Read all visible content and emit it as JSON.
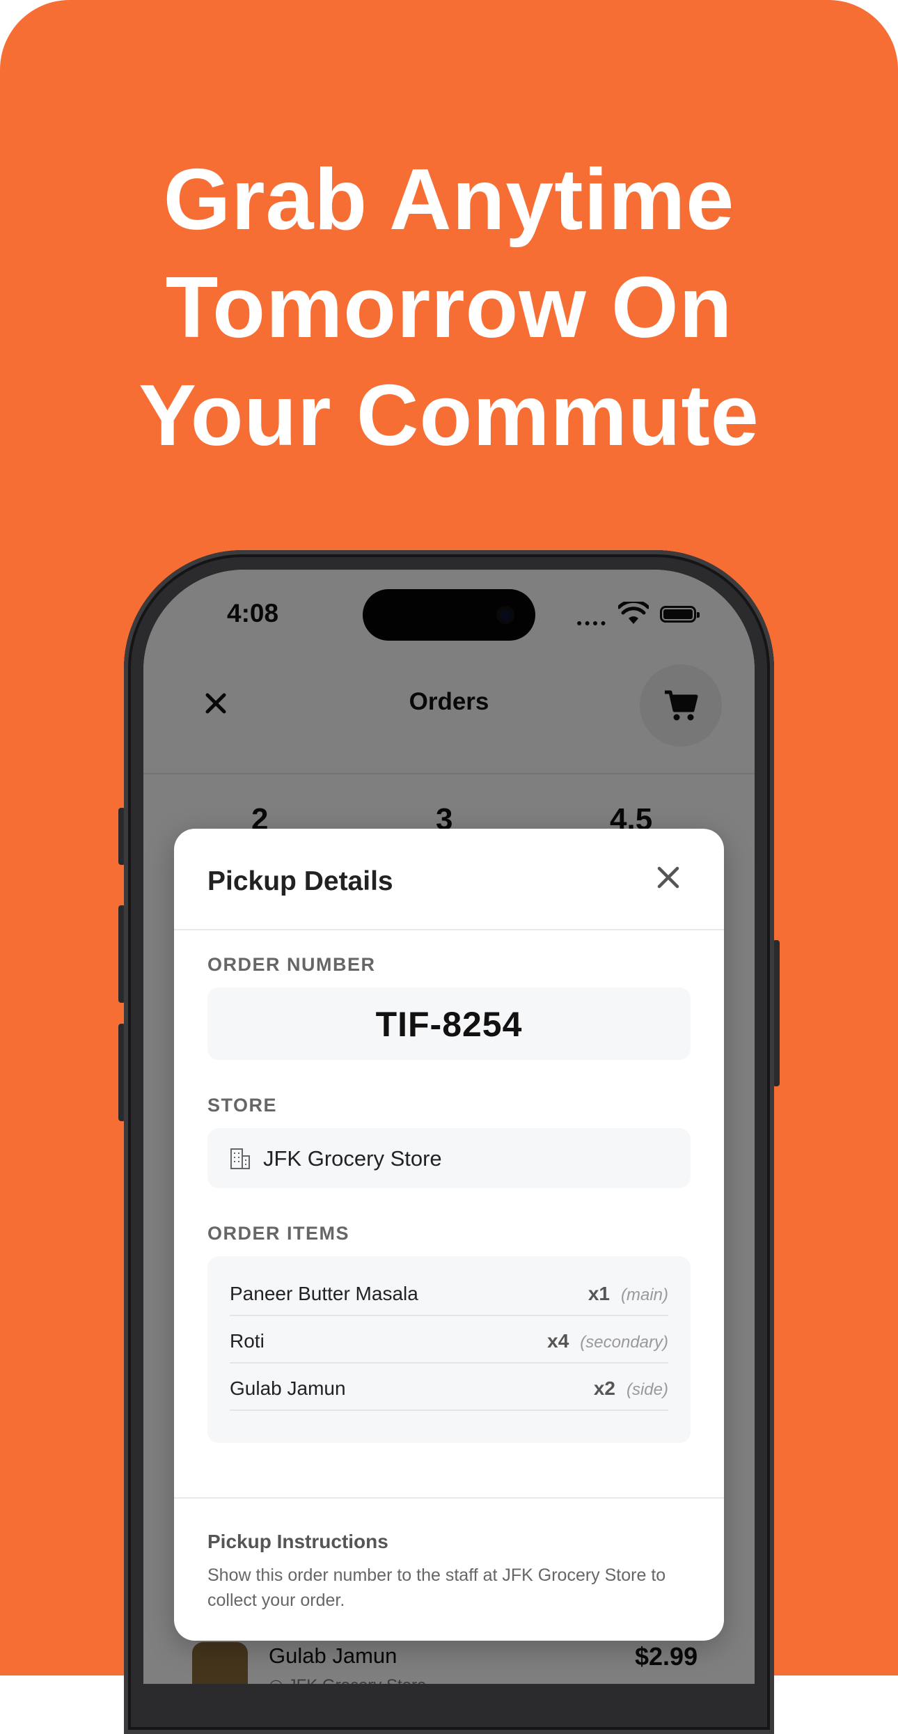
{
  "headline": {
    "lines": [
      "Grab Anytime",
      "Tomorrow On",
      "Your Commute"
    ]
  },
  "status_bar": {
    "time": "4:08"
  },
  "nav": {
    "title": "Orders"
  },
  "stats": {
    "values": [
      "2",
      "3",
      "4.5"
    ]
  },
  "background_list": {
    "item_name": "Gulab Jamun",
    "item_store": "JFK Grocery Store",
    "item_price": "$2.99"
  },
  "modal": {
    "title": "Pickup Details",
    "order_number_label": "ORDER NUMBER",
    "order_number": "TIF-8254",
    "store_label": "STORE",
    "store_name": "JFK Grocery Store",
    "items_label": "ORDER ITEMS",
    "items": [
      {
        "name": "Paneer Butter Masala",
        "qty": "x1",
        "role": "(main)"
      },
      {
        "name": "Roti",
        "qty": "x4",
        "role": "(secondary)"
      },
      {
        "name": "Gulab Jamun",
        "qty": "x2",
        "role": "(side)"
      }
    ],
    "instructions_title": "Pickup Instructions",
    "instructions_text": "Show this order number to the staff at JFK Grocery Store to collect your order."
  },
  "colors": {
    "brand_background": "#F76E35",
    "modal_box": "#F6F7F9"
  },
  "icons": [
    "close-icon",
    "cart-icon",
    "wifi-icon",
    "battery-icon",
    "building-icon",
    "location-pin-icon"
  ]
}
